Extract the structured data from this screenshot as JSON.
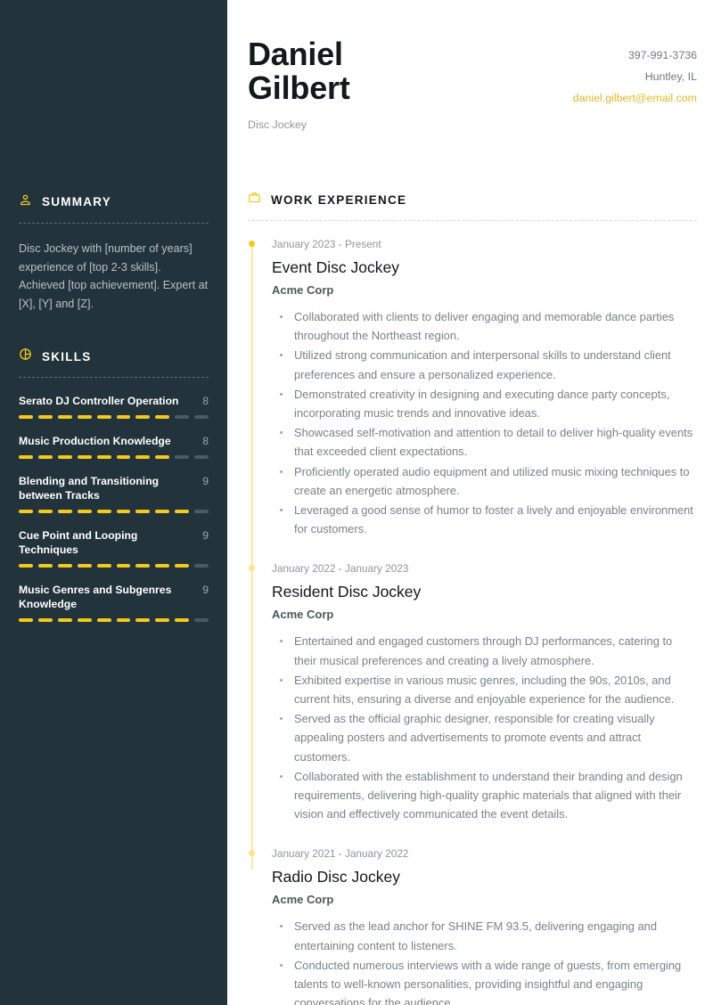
{
  "colors": {
    "sidebar_bg": "#22333b",
    "accent": "#f2c91d",
    "accent_text": "#e0b92a",
    "body_text": "#77838a",
    "heading": "#12181b"
  },
  "header": {
    "first_name": "Daniel",
    "last_name": "Gilbert",
    "role": "Disc Jockey",
    "phone": "397-991-3736",
    "location": "Huntley, IL",
    "email": "daniel.gilbert@email.com"
  },
  "sidebar": {
    "summary": {
      "icon": "person-icon",
      "title": "SUMMARY",
      "text": "Disc Jockey with [number of years] experience of [top 2-3 skills]. Achieved [top achievement]. Expert at [X], [Y] and [Z]."
    },
    "skills": {
      "icon": "pie-chart-icon",
      "title": "SKILLS",
      "max": 10,
      "items": [
        {
          "name": "Serato DJ Controller Operation",
          "score": 8
        },
        {
          "name": "Music Production Knowledge",
          "score": 8
        },
        {
          "name": "Blending and Transitioning between Tracks",
          "score": 9
        },
        {
          "name": "Cue Point and Looping Techniques",
          "score": 9
        },
        {
          "name": "Music Genres and Subgenres Knowledge",
          "score": 9
        }
      ]
    }
  },
  "work": {
    "icon": "briefcase-icon",
    "title": "WORK EXPERIENCE",
    "jobs": [
      {
        "date": "January 2023 - Present",
        "title": "Event Disc Jockey",
        "company": "Acme Corp",
        "bullets": [
          "Collaborated with clients to deliver engaging and memorable dance parties throughout the Northeast region.",
          "Utilized strong communication and interpersonal skills to understand client preferences and ensure a personalized experience.",
          "Demonstrated creativity in designing and executing dance party concepts, incorporating music trends and innovative ideas.",
          "Showcased self-motivation and attention to detail to deliver high-quality events that exceeded client expectations.",
          "Proficiently operated audio equipment and utilized music mixing techniques to create an energetic atmosphere.",
          "Leveraged a good sense of humor to foster a lively and enjoyable environment for customers."
        ]
      },
      {
        "date": "January 2022 - January 2023",
        "title": "Resident Disc Jockey",
        "company": "Acme Corp",
        "bullets": [
          "Entertained and engaged customers through DJ performances, catering to their musical preferences and creating a lively atmosphere.",
          "Exhibited expertise in various music genres, including the 90s, 2010s, and current hits, ensuring a diverse and enjoyable experience for the audience.",
          "Served as the official graphic designer, responsible for creating visually appealing posters and advertisements to promote events and attract customers.",
          "Collaborated with the establishment to understand their branding and design requirements, delivering high-quality graphic materials that aligned with their vision and effectively communicated the event details."
        ]
      },
      {
        "date": "January 2021 - January 2022",
        "title": "Radio Disc Jockey",
        "company": "Acme Corp",
        "bullets": [
          "Served as the lead anchor for SHINE FM 93.5, delivering engaging and entertaining content to listeners.",
          "Conducted numerous interviews with a wide range of guests, from emerging talents to well-known personalities, providing insightful and engaging conversations for the audience."
        ]
      }
    ]
  }
}
